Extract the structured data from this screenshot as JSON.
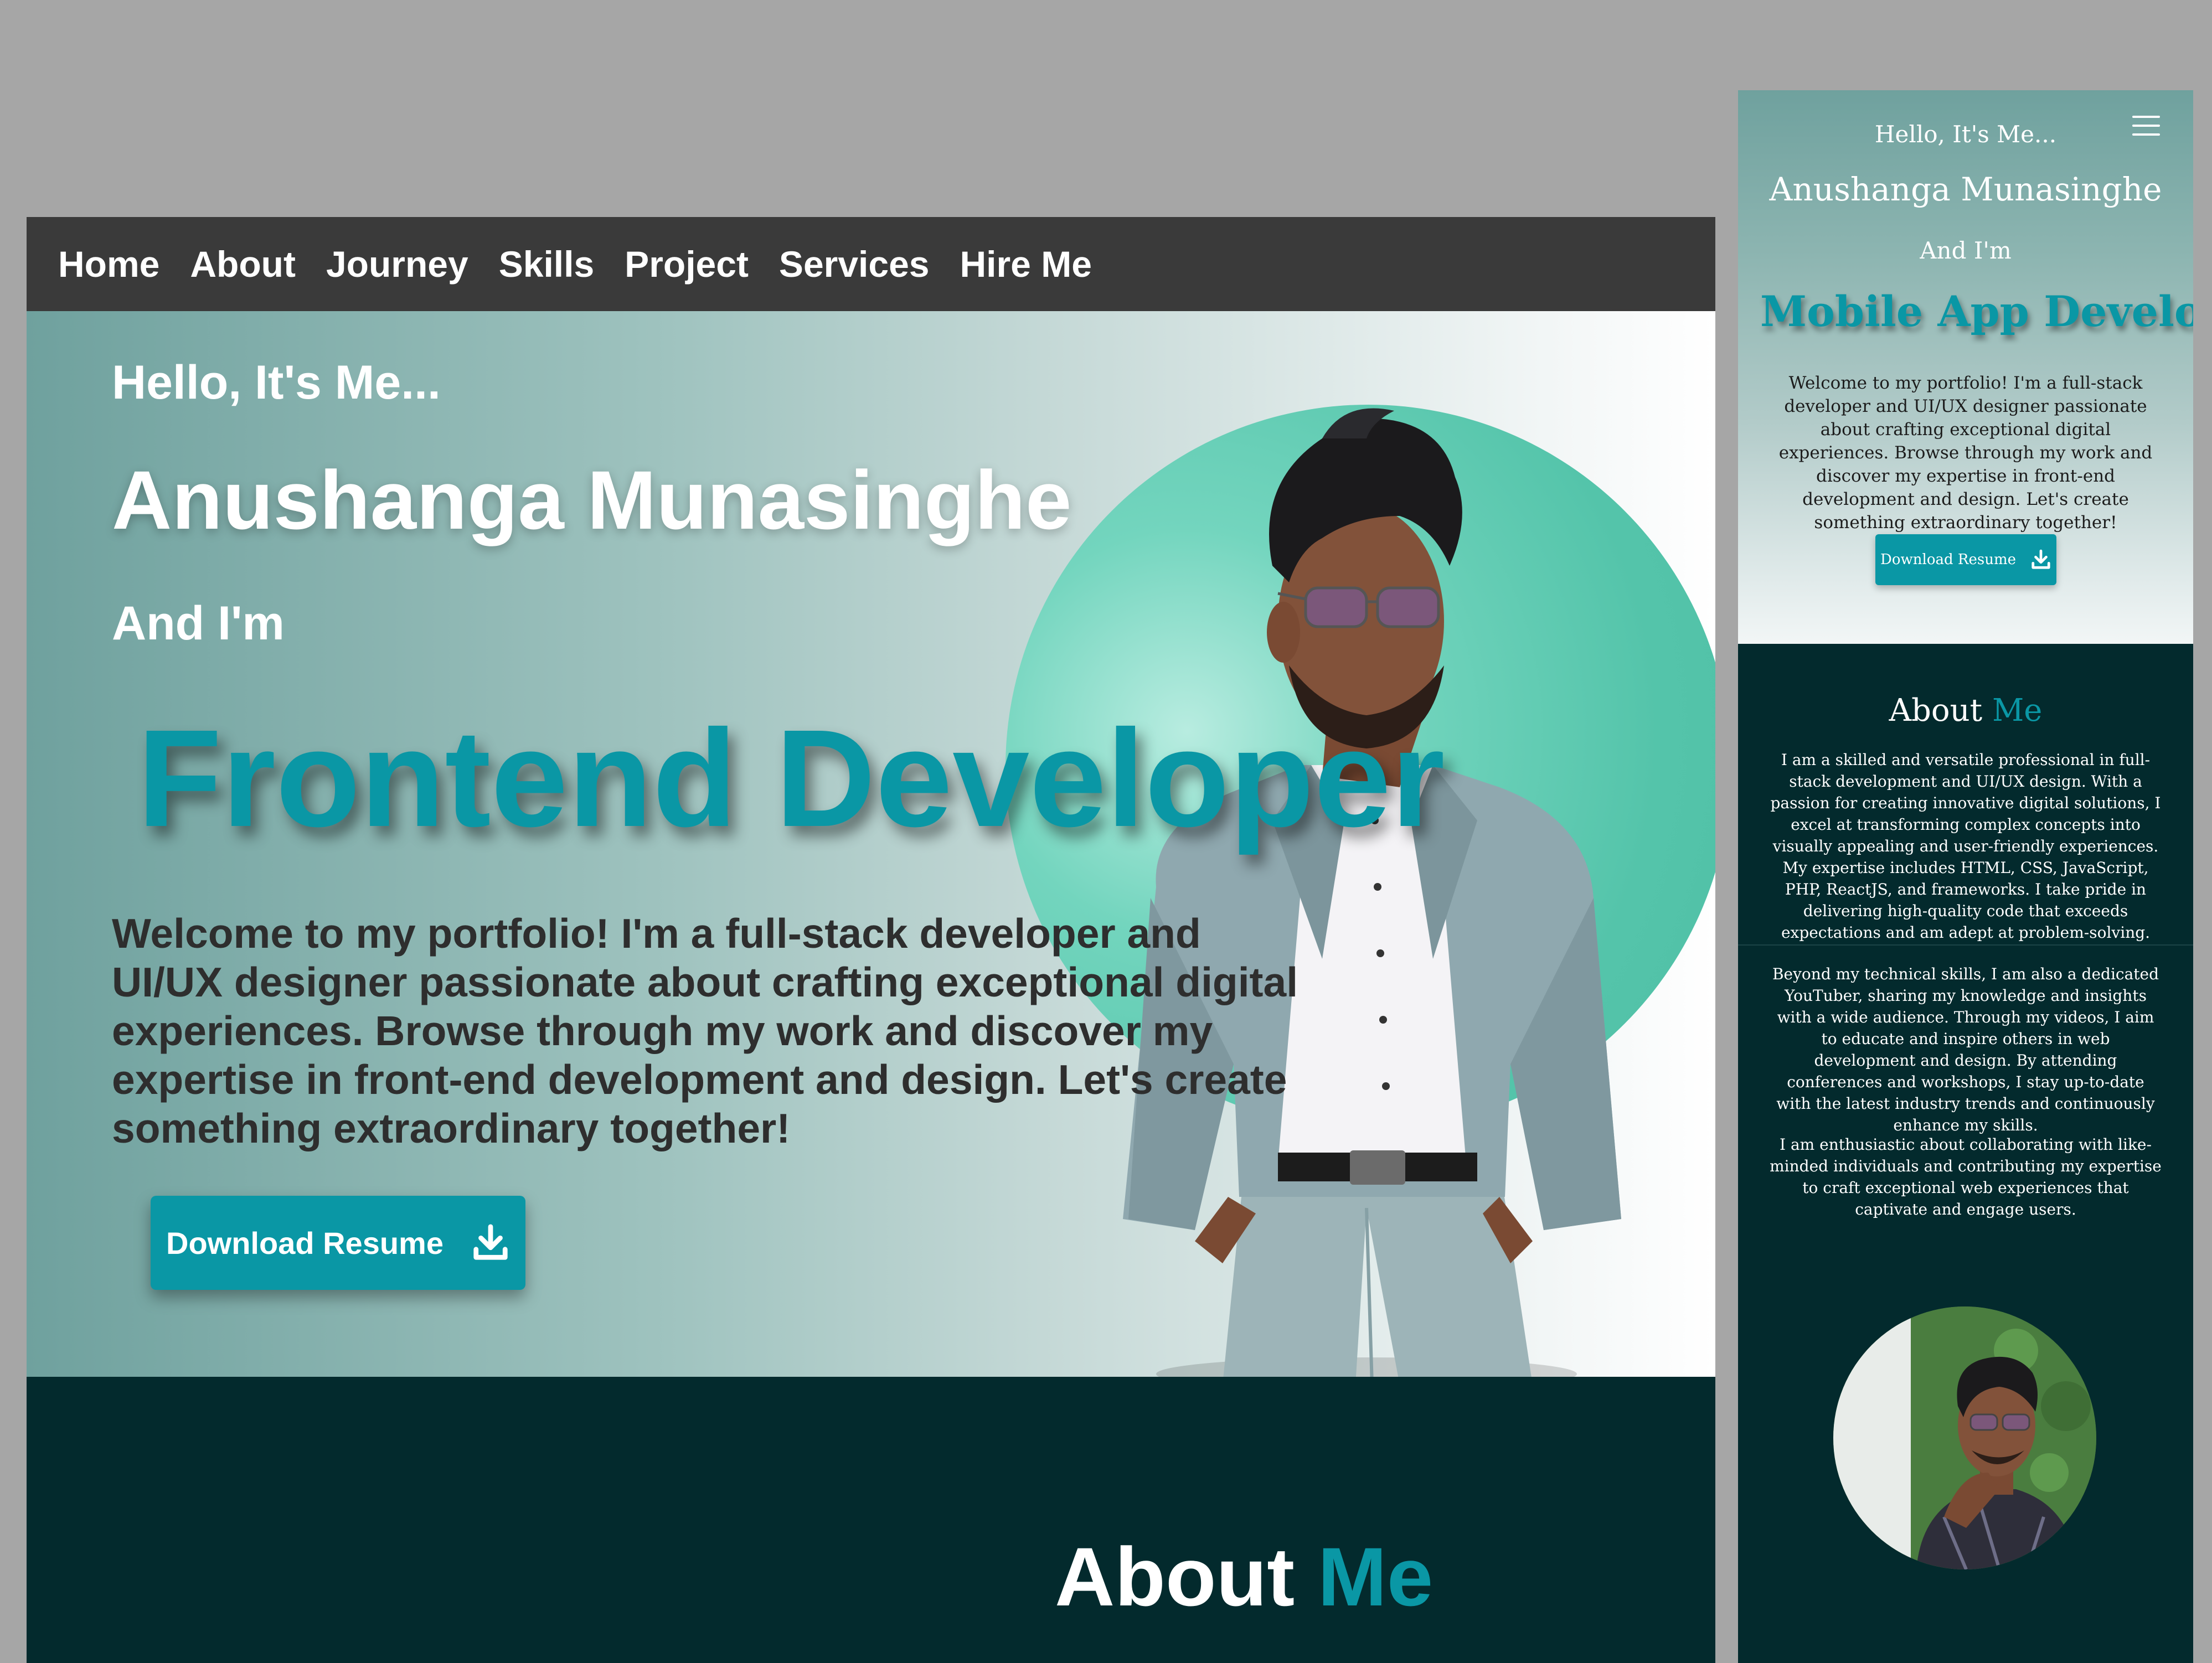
{
  "desktop": {
    "nav": [
      "Home",
      "About",
      "Journey",
      "Skills",
      "Project",
      "Services",
      "Hire Me"
    ],
    "hero": {
      "greeting": "Hello, It's Me...",
      "name": "Anushanga Munasinghe",
      "and_im": "And I'm",
      "role": "Frontend Developer",
      "description": "Welcome to my portfolio! I'm a full-stack developer and UI/UX designer passionate about crafting exceptional digital experiences. Browse through my work and discover my expertise in front-end development and design. Let's create something extraordinary together!",
      "download_button": "Download Resume"
    },
    "about": {
      "title_main": "About",
      "title_accent": "Me"
    }
  },
  "mobile": {
    "hero": {
      "greeting": "Hello, It's Me...",
      "name": "Anushanga Munasinghe",
      "and_im": "And I'm",
      "role": "Mobile App Developer|",
      "description": "Welcome to my portfolio! I'm a full-stack developer and UI/UX designer passionate about crafting exceptional digital experiences. Browse through my work and discover my expertise in front-end development and design. Let's create something extraordinary together!",
      "download_button": "Download Resume"
    },
    "about": {
      "title_main": "About",
      "title_accent": "Me",
      "paragraphs": [
        "I am a skilled and versatile professional in full-stack development and UI/UX design. With a passion for creating innovative digital solutions, I excel at transforming complex concepts into visually appealing and user-friendly experiences. My expertise includes HTML, CSS, JavaScript, PHP, ReactJS, and frameworks. I take pride in delivering high-quality code that exceeds expectations and am adept at problem-solving.",
        "Beyond my technical skills, I am also a dedicated YouTuber, sharing my knowledge and insights with a wide audience. Through my videos, I aim to educate and inspire others in web development and design. By attending conferences and workshops, I stay up-to-date with the latest industry trends and continuously enhance my skills.",
        "I am enthusiastic about collaborating with like-minded individuals and contributing my expertise to craft exceptional web experiences that captivate and engage users."
      ]
    }
  },
  "colors": {
    "accent": "#0a97a5",
    "nav_bg": "#3a3a3a",
    "dark_section": "#032a2d",
    "circle": "#54c4aa",
    "page_bg": "#a6a6a6"
  },
  "icons": [
    "download-icon",
    "hamburger-menu-icon"
  ]
}
